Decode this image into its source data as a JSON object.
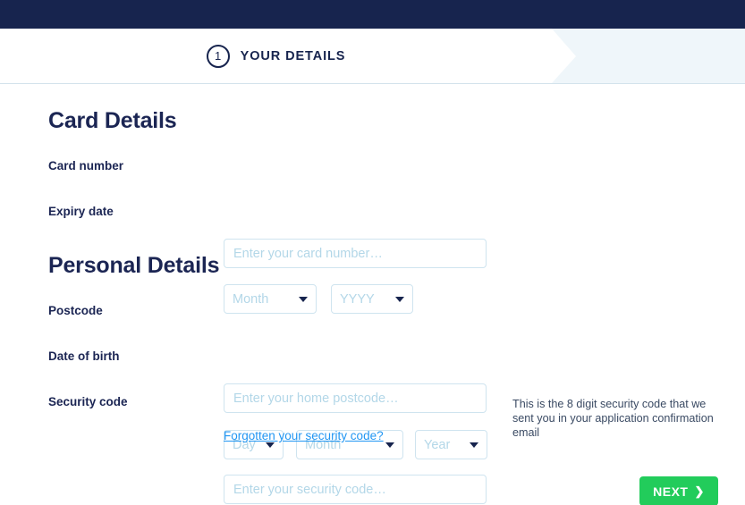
{
  "topbar": {
    "color": "#17244e"
  },
  "stepper": {
    "active_step_number": "1",
    "active_step_label": "YOUR DETAILS"
  },
  "sections": {
    "card_details": {
      "heading": "Card Details",
      "fields": {
        "card_number": {
          "label": "Card number",
          "placeholder": "Enter your card number…",
          "value": ""
        },
        "expiry_date": {
          "label": "Expiry date",
          "month_value": "Month",
          "year_value": "YYYY"
        }
      }
    },
    "personal_details": {
      "heading": "Personal Details",
      "fields": {
        "postcode": {
          "label": "Postcode",
          "placeholder": "Enter your home postcode…",
          "value": ""
        },
        "date_of_birth": {
          "label": "Date of birth",
          "day_value": "Day",
          "month_value": "Month",
          "year_value": "Year"
        },
        "security_code": {
          "label": "Security code",
          "placeholder": "Enter your security code…",
          "value": "",
          "help_link": "Forgotten your security code?",
          "hint": "This is the 8 digit security code that we sent you in your application confirmation email"
        }
      }
    }
  },
  "footer": {
    "next_label": "NEXT",
    "next_icon": "chevron-right-icon",
    "next_color": "#22cc5b"
  }
}
